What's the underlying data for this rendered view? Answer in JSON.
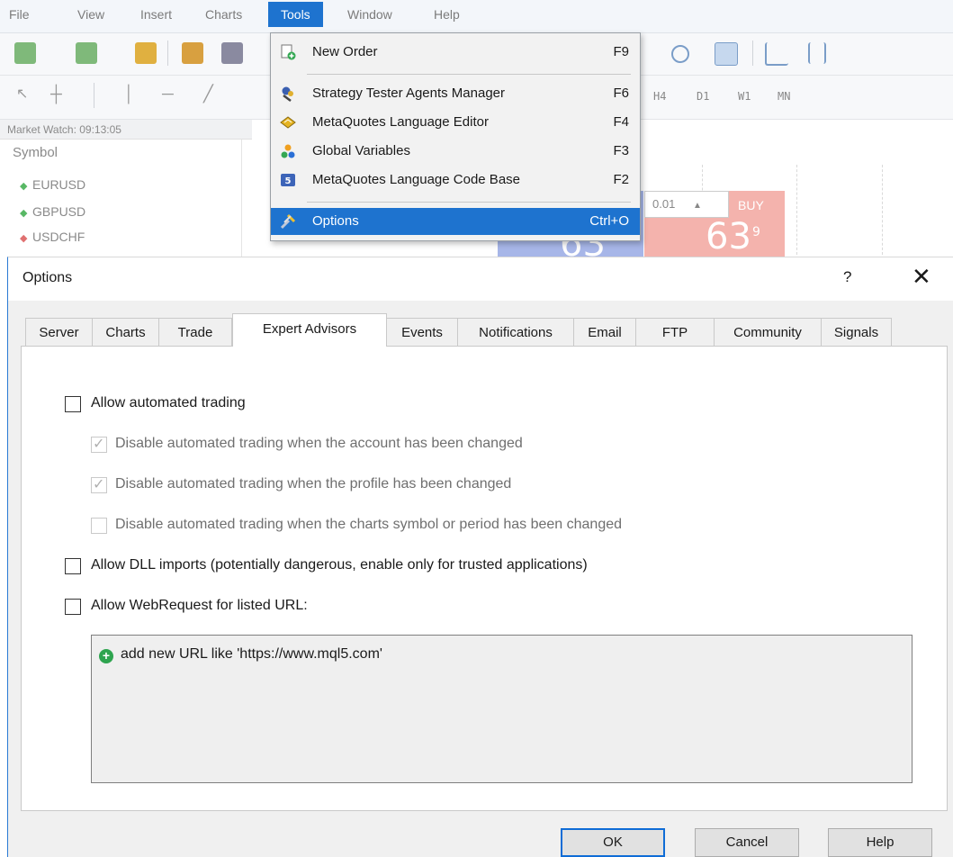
{
  "menubar": {
    "items": [
      "File",
      "View",
      "Insert",
      "Charts",
      "Tools",
      "Window",
      "Help"
    ],
    "active": "Tools"
  },
  "toolbar2": {
    "timeframes": [
      "H4",
      "D1",
      "W1",
      "MN"
    ]
  },
  "market_watch": {
    "title": "Market Watch: 09:13:05",
    "header": "Symbol",
    "rows": [
      {
        "symbol": "EURUSD",
        "dir": "up"
      },
      {
        "symbol": "GBPUSD",
        "dir": "up"
      },
      {
        "symbol": "USDCHF",
        "dir": "down"
      }
    ]
  },
  "trade_widget": {
    "lot": "0.01",
    "buy_label": "BUY",
    "price_big": "63",
    "price_sup": "9"
  },
  "tools_menu": {
    "items": [
      {
        "label": "New Order",
        "shortcut": "F9",
        "icon": "new-order-icon"
      },
      {
        "label": "Strategy Tester Agents Manager",
        "shortcut": "F6",
        "icon": "strategy-tester-icon"
      },
      {
        "label": "MetaQuotes Language Editor",
        "shortcut": "F4",
        "icon": "metaeditor-icon"
      },
      {
        "label": "Global Variables",
        "shortcut": "F3",
        "icon": "global-variables-icon"
      },
      {
        "label": "MetaQuotes Language Code Base",
        "shortcut": "F2",
        "icon": "codebase-icon"
      },
      {
        "label": "Options",
        "shortcut": "Ctrl+O",
        "icon": "options-icon",
        "selected": true
      }
    ]
  },
  "dialog": {
    "title": "Options",
    "help_glyph": "?",
    "close_glyph": "✕",
    "tabs": [
      "Server",
      "Charts",
      "Trade",
      "Expert Advisors",
      "Events",
      "Notifications",
      "Email",
      "FTP",
      "Community",
      "Signals"
    ],
    "active_tab": "Expert Advisors",
    "options": {
      "allow_auto": {
        "label": "Allow automated trading",
        "checked": false,
        "enabled": true
      },
      "disable_account": {
        "label": "Disable automated trading when the account has been changed",
        "checked": true,
        "enabled": false
      },
      "disable_profile": {
        "label": "Disable automated trading when the profile has been changed",
        "checked": true,
        "enabled": false
      },
      "disable_symbol": {
        "label": "Disable automated trading when the charts symbol or period has been changed",
        "checked": false,
        "enabled": false
      },
      "allow_dll": {
        "label": "Allow DLL imports (potentially dangerous, enable only for trusted applications)",
        "checked": false,
        "enabled": true
      },
      "allow_webrequest": {
        "label": "Allow WebRequest for listed URL:",
        "checked": false,
        "enabled": true
      }
    },
    "url_list": {
      "add_text": "add new URL like 'https://www.mql5.com'"
    },
    "buttons": {
      "ok": "OK",
      "cancel": "Cancel",
      "help": "Help"
    }
  },
  "colors": {
    "accent": "#1e73cf",
    "buy": "#f4b3ad",
    "sell": "#a7b6e8",
    "add": "#2ea44f"
  }
}
